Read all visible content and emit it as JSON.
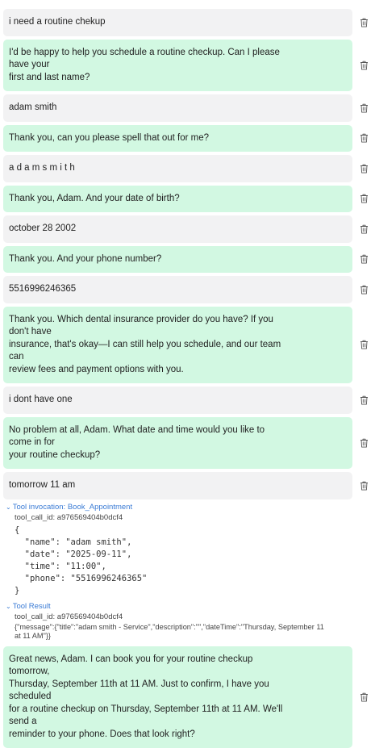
{
  "messages": [
    {
      "role": "user",
      "text": "i need a routine chekup"
    },
    {
      "role": "assistant",
      "text": "I'd be happy to help you schedule a routine checkup. Can I please have your\nfirst and last name?"
    },
    {
      "role": "user",
      "text": "adam smith"
    },
    {
      "role": "assistant",
      "text": "Thank you, can you please spell that out for me?"
    },
    {
      "role": "user",
      "text": "a d a m s m i t h"
    },
    {
      "role": "assistant",
      "text": "Thank you, Adam. And your date of birth?"
    },
    {
      "role": "user",
      "text": "october 28 2002"
    },
    {
      "role": "assistant",
      "text": "Thank you. And your phone number?"
    },
    {
      "role": "user",
      "text": "5516996246365"
    },
    {
      "role": "assistant",
      "text": "Thank you. Which dental insurance provider do you have? If you don't have\ninsurance, that's okay—I can still help you schedule, and our team can\nreview fees and payment options with you."
    },
    {
      "role": "user",
      "text": "i dont have one"
    },
    {
      "role": "assistant",
      "text": "No problem at all, Adam. What date and time would you like to come in for\nyour routine checkup?"
    },
    {
      "role": "user",
      "text": "tomorrow 11 am"
    }
  ],
  "tool_invocation": {
    "caret": "⌄",
    "label": "Tool invocation: Book_Appointment",
    "call_id": "tool_call_id: a976569404b0dcf4",
    "args": "{\n  \"name\": \"adam smith\",\n  \"date\": \"2025-09-11\",\n  \"time\": \"11:00\",\n  \"phone\": \"5516996246365\"\n}"
  },
  "tool_result": {
    "caret": "⌄",
    "label": "Tool Result",
    "call_id": "tool_call_id: a976569404b0dcf4",
    "text": "{\"message\":{\"title\":\"adam smith - Service\",\"description\":\"\",\"dateTime\":\"Thursday, September 11 at 11 AM\"}}"
  },
  "final_message": {
    "role": "assistant",
    "text": "Great news, Adam. I can book you for your routine checkup tomorrow,\nThursday, September 11th at 11 AM. Just to confirm, I have you scheduled\nfor a routine checkup on Thursday, September 11th at 11 AM. We'll send a\nreminder to your phone. Does that look right?"
  },
  "icons": {
    "delete": "trash-icon"
  },
  "colors": {
    "user_bubble": "#f2f2f3",
    "assistant_bubble": "#d2f8e2",
    "link": "#3a7bd5"
  }
}
